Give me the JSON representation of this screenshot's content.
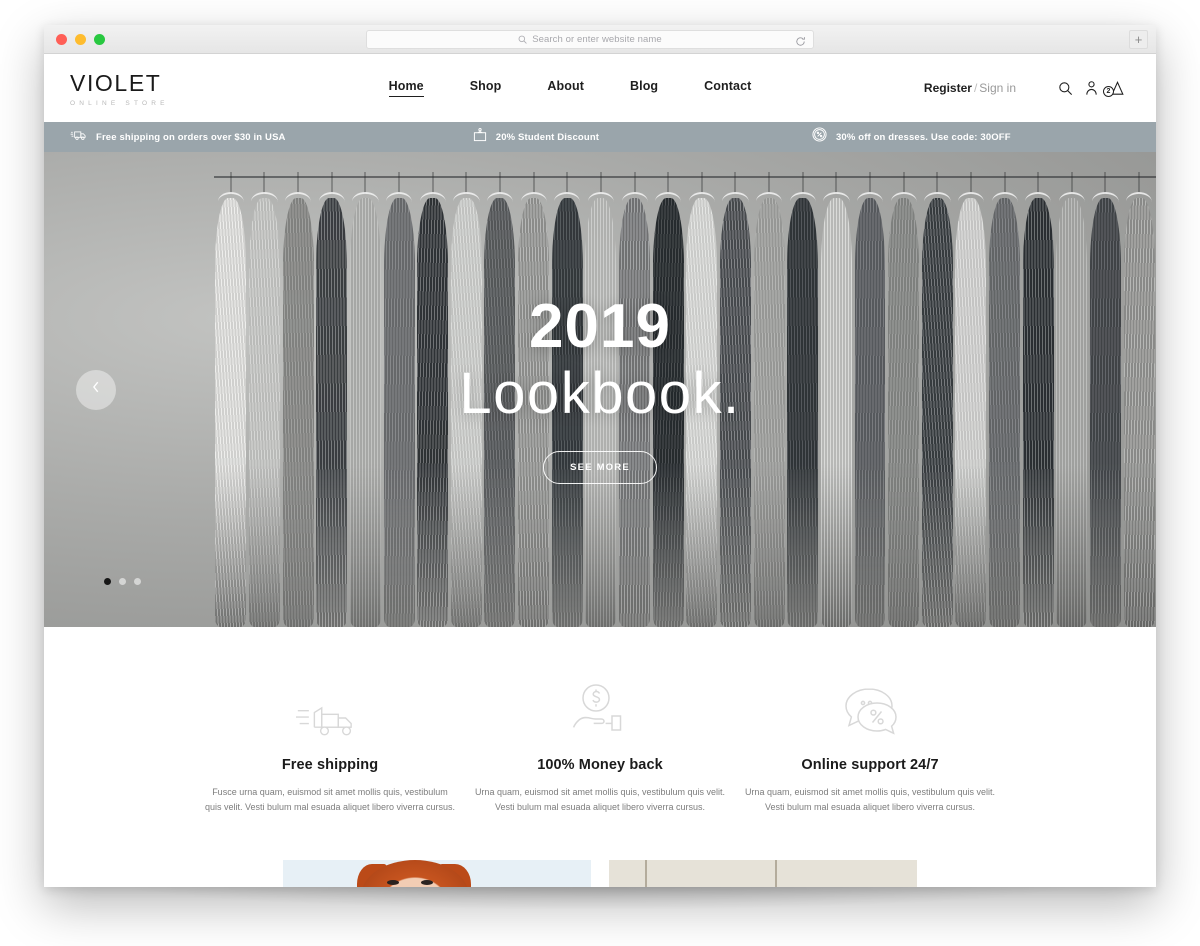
{
  "browser": {
    "window_controls": [
      "close",
      "minimize",
      "maximize"
    ],
    "address_bar": {
      "placeholder": "Search or enter website name",
      "value": "",
      "search_icon": "search-icon",
      "reload_icon": "reload-icon"
    },
    "new_tab_label": "+"
  },
  "site": {
    "logo": {
      "name": "VIOLET",
      "tagline": "ONLINE STORE"
    },
    "nav": [
      {
        "label": "Home",
        "active": true
      },
      {
        "label": "Shop",
        "active": false
      },
      {
        "label": "About",
        "active": false
      },
      {
        "label": "Blog",
        "active": false
      },
      {
        "label": "Contact",
        "active": false
      }
    ],
    "account": {
      "register_label": "Register",
      "separator": "/",
      "signin_label": "Sign in"
    },
    "header_icons": [
      {
        "name": "search-icon"
      },
      {
        "name": "user-icon"
      },
      {
        "name": "cart-icon",
        "badge": "2"
      }
    ],
    "promo_bar": {
      "background": "#9aa5ab",
      "items": [
        {
          "icon": "truck-icon",
          "text": "Free shipping on orders over $30 in USA"
        },
        {
          "icon": "student-card-icon",
          "text": "20% Student Discount"
        },
        {
          "icon": "percent-badge-icon",
          "text": "30% off on dresses. Use code: 30OFF"
        }
      ]
    },
    "hero": {
      "title_line1": "2019",
      "title_line2": "Lookbook.",
      "cta_label": "SEE MORE",
      "prev_icon": "chevron-left-icon",
      "slide_count": 3,
      "active_slide": 1
    },
    "features": [
      {
        "icon": "delivery-truck-icon",
        "title": "Free shipping",
        "text": "Fusce urna quam, euismod sit amet mollis quis, vestibulum quis velit. Vesti bulum mal esuada aliquet libero viverra cursus."
      },
      {
        "icon": "money-back-hand-icon",
        "title": "100% Money back",
        "text": "Urna quam, euismod sit amet mollis quis, vestibulum quis velit. Vesti bulum mal esuada aliquet libero viverra cursus."
      },
      {
        "icon": "chat-support-icon",
        "title": "Online support 24/7",
        "text": "Urna quam, euismod sit amet mollis quis, vestibulum quis velit. Vesti bulum mal esuada aliquet libero viverra cursus."
      }
    ]
  }
}
